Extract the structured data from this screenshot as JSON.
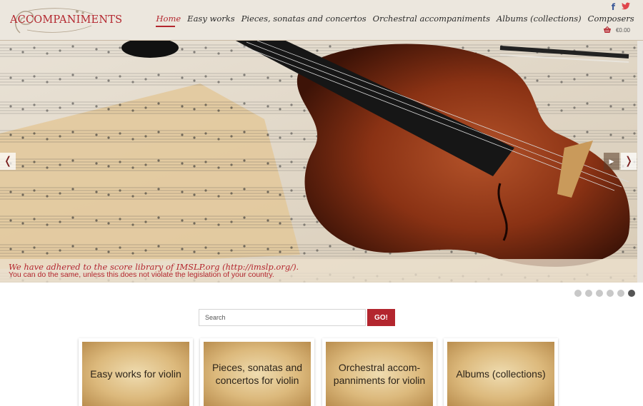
{
  "site": {
    "logo_text": "ACCOMPANIMENTS"
  },
  "nav": {
    "items": [
      {
        "label": "Home",
        "active": true
      },
      {
        "label": "Easy works"
      },
      {
        "label": "Pieces, sonatas and concertos"
      },
      {
        "label": "Orchestral accompaniments"
      },
      {
        "label": "Albums (collections)"
      },
      {
        "label": "Composers"
      }
    ]
  },
  "header": {
    "social": {
      "facebook_icon": "f",
      "twitter_icon": "twitter-bird"
    },
    "cart_total": "€0.00"
  },
  "hero": {
    "caption_line1": "We have adhered to the score library of IMSLP.org (http://imslp.org/).",
    "caption_line2": "You can do the same, unless this does not violate the legislation of your country.",
    "prev_icon": "❬",
    "play_icon": "▶",
    "next_icon": "❭",
    "slides_count": 6,
    "active_slide": 6
  },
  "search": {
    "placeholder": "Search",
    "button_label": "GO!"
  },
  "categories": [
    {
      "label": "Easy works for violin"
    },
    {
      "label": "Pieces, sonatas and concertos for violin"
    },
    {
      "label": "Orchestral accom-panniments for violin"
    },
    {
      "label": "Albums (collections)"
    }
  ],
  "colors": {
    "accent": "#b3262e",
    "header_bg": "#ece7de",
    "facebook": "#3b5998"
  }
}
